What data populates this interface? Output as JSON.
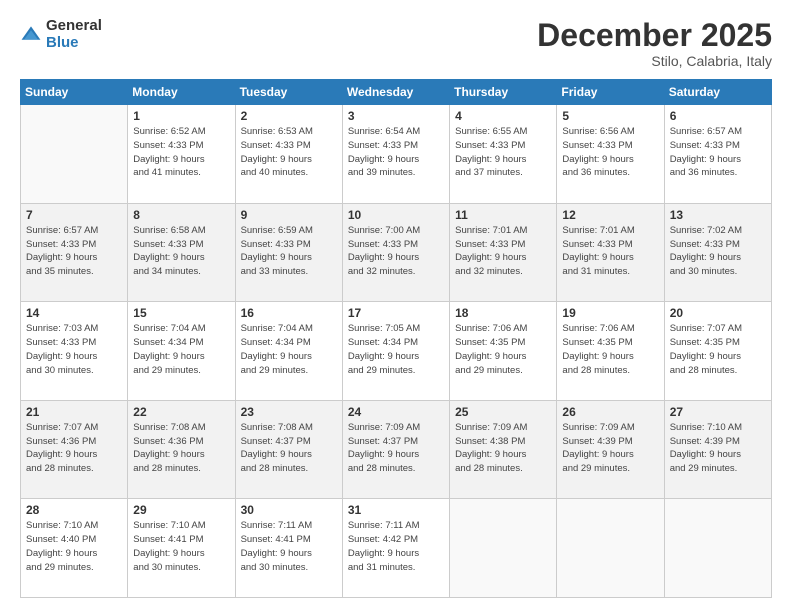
{
  "header": {
    "logo_general": "General",
    "logo_blue": "Blue",
    "month_title": "December 2025",
    "subtitle": "Stilo, Calabria, Italy"
  },
  "days_of_week": [
    "Sunday",
    "Monday",
    "Tuesday",
    "Wednesday",
    "Thursday",
    "Friday",
    "Saturday"
  ],
  "weeks": [
    [
      {
        "day": "",
        "info": ""
      },
      {
        "day": "1",
        "info": "Sunrise: 6:52 AM\nSunset: 4:33 PM\nDaylight: 9 hours\nand 41 minutes."
      },
      {
        "day": "2",
        "info": "Sunrise: 6:53 AM\nSunset: 4:33 PM\nDaylight: 9 hours\nand 40 minutes."
      },
      {
        "day": "3",
        "info": "Sunrise: 6:54 AM\nSunset: 4:33 PM\nDaylight: 9 hours\nand 39 minutes."
      },
      {
        "day": "4",
        "info": "Sunrise: 6:55 AM\nSunset: 4:33 PM\nDaylight: 9 hours\nand 37 minutes."
      },
      {
        "day": "5",
        "info": "Sunrise: 6:56 AM\nSunset: 4:33 PM\nDaylight: 9 hours\nand 36 minutes."
      },
      {
        "day": "6",
        "info": "Sunrise: 6:57 AM\nSunset: 4:33 PM\nDaylight: 9 hours\nand 36 minutes."
      }
    ],
    [
      {
        "day": "7",
        "info": "Sunrise: 6:57 AM\nSunset: 4:33 PM\nDaylight: 9 hours\nand 35 minutes."
      },
      {
        "day": "8",
        "info": "Sunrise: 6:58 AM\nSunset: 4:33 PM\nDaylight: 9 hours\nand 34 minutes."
      },
      {
        "day": "9",
        "info": "Sunrise: 6:59 AM\nSunset: 4:33 PM\nDaylight: 9 hours\nand 33 minutes."
      },
      {
        "day": "10",
        "info": "Sunrise: 7:00 AM\nSunset: 4:33 PM\nDaylight: 9 hours\nand 32 minutes."
      },
      {
        "day": "11",
        "info": "Sunrise: 7:01 AM\nSunset: 4:33 PM\nDaylight: 9 hours\nand 32 minutes."
      },
      {
        "day": "12",
        "info": "Sunrise: 7:01 AM\nSunset: 4:33 PM\nDaylight: 9 hours\nand 31 minutes."
      },
      {
        "day": "13",
        "info": "Sunrise: 7:02 AM\nSunset: 4:33 PM\nDaylight: 9 hours\nand 30 minutes."
      }
    ],
    [
      {
        "day": "14",
        "info": "Sunrise: 7:03 AM\nSunset: 4:33 PM\nDaylight: 9 hours\nand 30 minutes."
      },
      {
        "day": "15",
        "info": "Sunrise: 7:04 AM\nSunset: 4:34 PM\nDaylight: 9 hours\nand 29 minutes."
      },
      {
        "day": "16",
        "info": "Sunrise: 7:04 AM\nSunset: 4:34 PM\nDaylight: 9 hours\nand 29 minutes."
      },
      {
        "day": "17",
        "info": "Sunrise: 7:05 AM\nSunset: 4:34 PM\nDaylight: 9 hours\nand 29 minutes."
      },
      {
        "day": "18",
        "info": "Sunrise: 7:06 AM\nSunset: 4:35 PM\nDaylight: 9 hours\nand 29 minutes."
      },
      {
        "day": "19",
        "info": "Sunrise: 7:06 AM\nSunset: 4:35 PM\nDaylight: 9 hours\nand 28 minutes."
      },
      {
        "day": "20",
        "info": "Sunrise: 7:07 AM\nSunset: 4:35 PM\nDaylight: 9 hours\nand 28 minutes."
      }
    ],
    [
      {
        "day": "21",
        "info": "Sunrise: 7:07 AM\nSunset: 4:36 PM\nDaylight: 9 hours\nand 28 minutes."
      },
      {
        "day": "22",
        "info": "Sunrise: 7:08 AM\nSunset: 4:36 PM\nDaylight: 9 hours\nand 28 minutes."
      },
      {
        "day": "23",
        "info": "Sunrise: 7:08 AM\nSunset: 4:37 PM\nDaylight: 9 hours\nand 28 minutes."
      },
      {
        "day": "24",
        "info": "Sunrise: 7:09 AM\nSunset: 4:37 PM\nDaylight: 9 hours\nand 28 minutes."
      },
      {
        "day": "25",
        "info": "Sunrise: 7:09 AM\nSunset: 4:38 PM\nDaylight: 9 hours\nand 28 minutes."
      },
      {
        "day": "26",
        "info": "Sunrise: 7:09 AM\nSunset: 4:39 PM\nDaylight: 9 hours\nand 29 minutes."
      },
      {
        "day": "27",
        "info": "Sunrise: 7:10 AM\nSunset: 4:39 PM\nDaylight: 9 hours\nand 29 minutes."
      }
    ],
    [
      {
        "day": "28",
        "info": "Sunrise: 7:10 AM\nSunset: 4:40 PM\nDaylight: 9 hours\nand 29 minutes."
      },
      {
        "day": "29",
        "info": "Sunrise: 7:10 AM\nSunset: 4:41 PM\nDaylight: 9 hours\nand 30 minutes."
      },
      {
        "day": "30",
        "info": "Sunrise: 7:11 AM\nSunset: 4:41 PM\nDaylight: 9 hours\nand 30 minutes."
      },
      {
        "day": "31",
        "info": "Sunrise: 7:11 AM\nSunset: 4:42 PM\nDaylight: 9 hours\nand 31 minutes."
      },
      {
        "day": "",
        "info": ""
      },
      {
        "day": "",
        "info": ""
      },
      {
        "day": "",
        "info": ""
      }
    ]
  ]
}
